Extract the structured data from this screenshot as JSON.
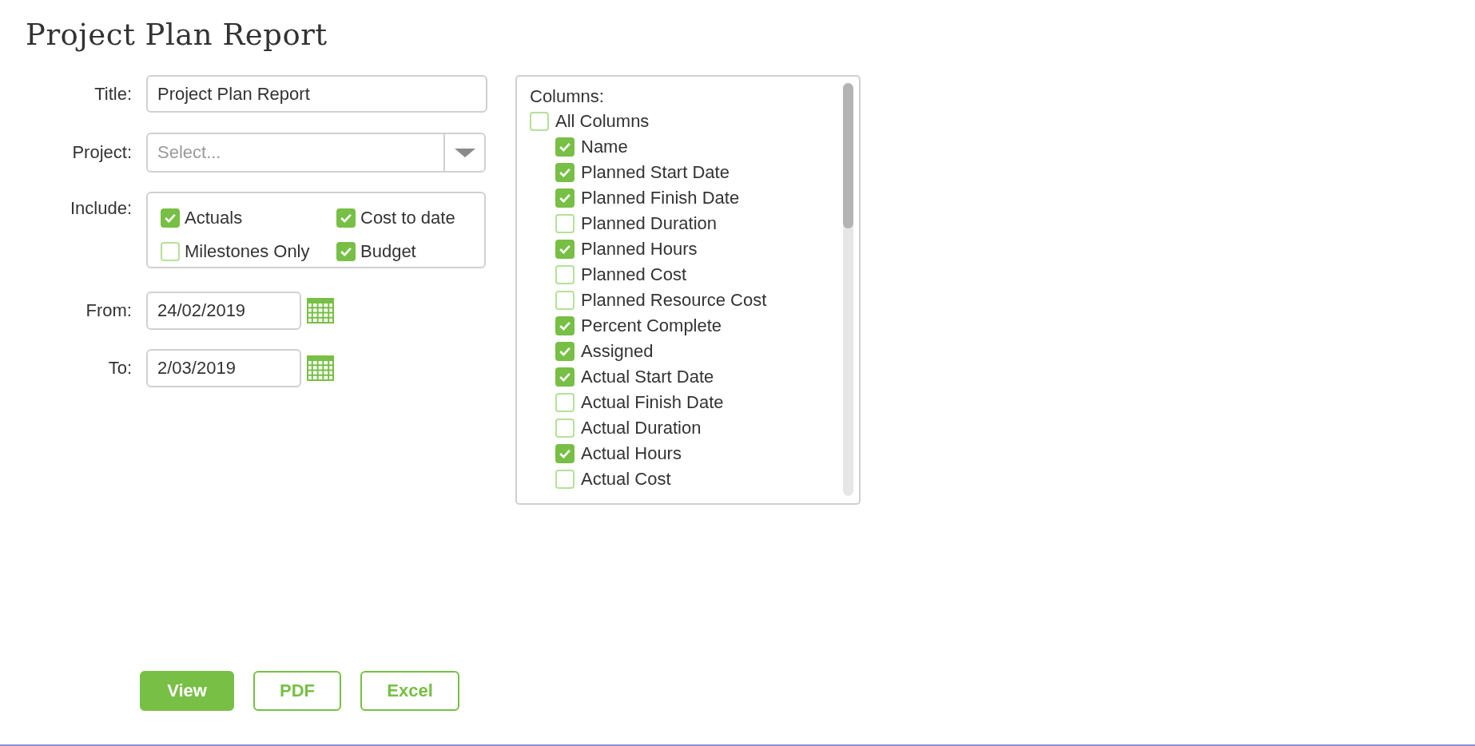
{
  "page": {
    "title": "Project Plan Report"
  },
  "form": {
    "title_field": {
      "label": "Title:",
      "value": "Project Plan Report"
    },
    "project_field": {
      "label": "Project:",
      "placeholder": "Select..."
    },
    "include": {
      "label": "Include:",
      "options": [
        {
          "label": "Actuals",
          "checked": true
        },
        {
          "label": "Cost to date",
          "checked": true
        },
        {
          "label": "Milestones Only",
          "checked": false
        },
        {
          "label": "Budget",
          "checked": true
        }
      ]
    },
    "from_field": {
      "label": "From:",
      "value": "24/02/2019"
    },
    "to_field": {
      "label": "To:",
      "value": "2/03/2019"
    }
  },
  "columns": {
    "label": "Columns:",
    "items": [
      {
        "label": "All Columns",
        "checked": false,
        "children": [
          {
            "label": "Name",
            "checked": true
          },
          {
            "label": "Planned Start Date",
            "checked": true
          },
          {
            "label": "Planned Finish Date",
            "checked": true
          },
          {
            "label": "Planned Duration",
            "checked": false
          },
          {
            "label": "Planned Hours",
            "checked": true
          },
          {
            "label": "Planned Cost",
            "checked": false
          },
          {
            "label": "Planned Resource Cost",
            "checked": false
          },
          {
            "label": "Percent Complete",
            "checked": true
          },
          {
            "label": "Assigned",
            "checked": true
          },
          {
            "label": "Actual Start Date",
            "checked": true
          },
          {
            "label": "Actual Finish Date",
            "checked": false
          },
          {
            "label": "Actual Duration",
            "checked": false
          },
          {
            "label": "Actual Hours",
            "checked": true
          },
          {
            "label": "Actual Cost",
            "checked": false
          }
        ]
      }
    ]
  },
  "buttons": [
    {
      "label": "View",
      "kind": "primary"
    },
    {
      "label": "PDF",
      "kind": "outline"
    },
    {
      "label": "Excel",
      "kind": "outline"
    }
  ]
}
